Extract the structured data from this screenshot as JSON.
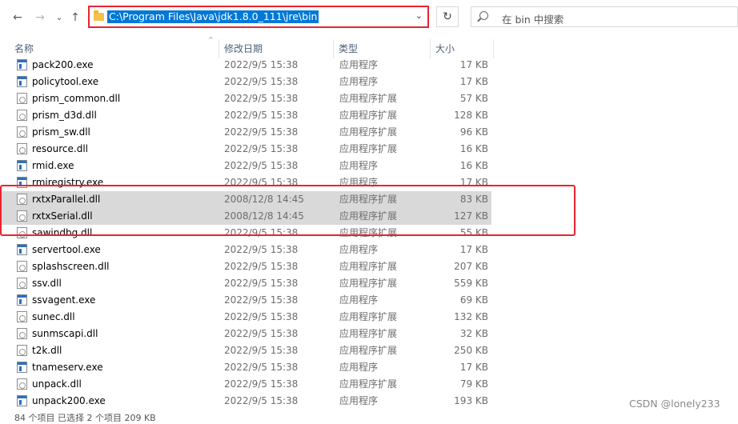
{
  "toolbar": {
    "back": "←",
    "forward": "→",
    "recent": "⌄",
    "up": "↑",
    "address": "C:\\Program Files\\Java\\jdk1.8.0_111\\jre\\bin",
    "address_dropdown": "⌄",
    "refresh": "↻",
    "search_placeholder": "在 bin 中搜索"
  },
  "columns": {
    "name": "名称",
    "date": "修改日期",
    "type": "类型",
    "size": "大小"
  },
  "files": [
    {
      "name": "pack200.exe",
      "date": "2022/9/5 15:38",
      "type": "应用程序",
      "size": "17 KB",
      "kind": "exe",
      "selected": false
    },
    {
      "name": "policytool.exe",
      "date": "2022/9/5 15:38",
      "type": "应用程序",
      "size": "17 KB",
      "kind": "exe",
      "selected": false
    },
    {
      "name": "prism_common.dll",
      "date": "2022/9/5 15:38",
      "type": "应用程序扩展",
      "size": "57 KB",
      "kind": "dll",
      "selected": false
    },
    {
      "name": "prism_d3d.dll",
      "date": "2022/9/5 15:38",
      "type": "应用程序扩展",
      "size": "128 KB",
      "kind": "dll",
      "selected": false
    },
    {
      "name": "prism_sw.dll",
      "date": "2022/9/5 15:38",
      "type": "应用程序扩展",
      "size": "96 KB",
      "kind": "dll",
      "selected": false
    },
    {
      "name": "resource.dll",
      "date": "2022/9/5 15:38",
      "type": "应用程序扩展",
      "size": "16 KB",
      "kind": "dll",
      "selected": false
    },
    {
      "name": "rmid.exe",
      "date": "2022/9/5 15:38",
      "type": "应用程序",
      "size": "16 KB",
      "kind": "exe",
      "selected": false
    },
    {
      "name": "rmiregistry.exe",
      "date": "2022/9/5 15:38",
      "type": "应用程序",
      "size": "17 KB",
      "kind": "exe",
      "selected": false
    },
    {
      "name": "rxtxParallel.dll",
      "date": "2008/12/8 14:45",
      "type": "应用程序扩展",
      "size": "83 KB",
      "kind": "dll",
      "selected": true
    },
    {
      "name": "rxtxSerial.dll",
      "date": "2008/12/8 14:45",
      "type": "应用程序扩展",
      "size": "127 KB",
      "kind": "dll",
      "selected": true
    },
    {
      "name": "sawindbg.dll",
      "date": "2022/9/5 15:38",
      "type": "应用程序扩展",
      "size": "55 KB",
      "kind": "dll",
      "selected": false
    },
    {
      "name": "servertool.exe",
      "date": "2022/9/5 15:38",
      "type": "应用程序",
      "size": "17 KB",
      "kind": "exe",
      "selected": false
    },
    {
      "name": "splashscreen.dll",
      "date": "2022/9/5 15:38",
      "type": "应用程序扩展",
      "size": "207 KB",
      "kind": "dll",
      "selected": false
    },
    {
      "name": "ssv.dll",
      "date": "2022/9/5 15:38",
      "type": "应用程序扩展",
      "size": "559 KB",
      "kind": "dll",
      "selected": false
    },
    {
      "name": "ssvagent.exe",
      "date": "2022/9/5 15:38",
      "type": "应用程序",
      "size": "69 KB",
      "kind": "exe",
      "selected": false
    },
    {
      "name": "sunec.dll",
      "date": "2022/9/5 15:38",
      "type": "应用程序扩展",
      "size": "132 KB",
      "kind": "dll",
      "selected": false
    },
    {
      "name": "sunmscapi.dll",
      "date": "2022/9/5 15:38",
      "type": "应用程序扩展",
      "size": "32 KB",
      "kind": "dll",
      "selected": false
    },
    {
      "name": "t2k.dll",
      "date": "2022/9/5 15:38",
      "type": "应用程序扩展",
      "size": "250 KB",
      "kind": "dll",
      "selected": false
    },
    {
      "name": "tnameserv.exe",
      "date": "2022/9/5 15:38",
      "type": "应用程序",
      "size": "17 KB",
      "kind": "exe",
      "selected": false
    },
    {
      "name": "unpack.dll",
      "date": "2022/9/5 15:38",
      "type": "应用程序扩展",
      "size": "79 KB",
      "kind": "dll",
      "selected": false
    },
    {
      "name": "unpack200.exe",
      "date": "2022/9/5 15:38",
      "type": "应用程序",
      "size": "193 KB",
      "kind": "exe",
      "selected": false
    }
  ],
  "status": "84 个项目    已选择 2 个项目  209 KB",
  "watermark": "CSDN @lonely233",
  "colors": {
    "selection": "#d9d9d9",
    "highlight_border": "#e8242f",
    "address_selection": "#0078d7"
  }
}
